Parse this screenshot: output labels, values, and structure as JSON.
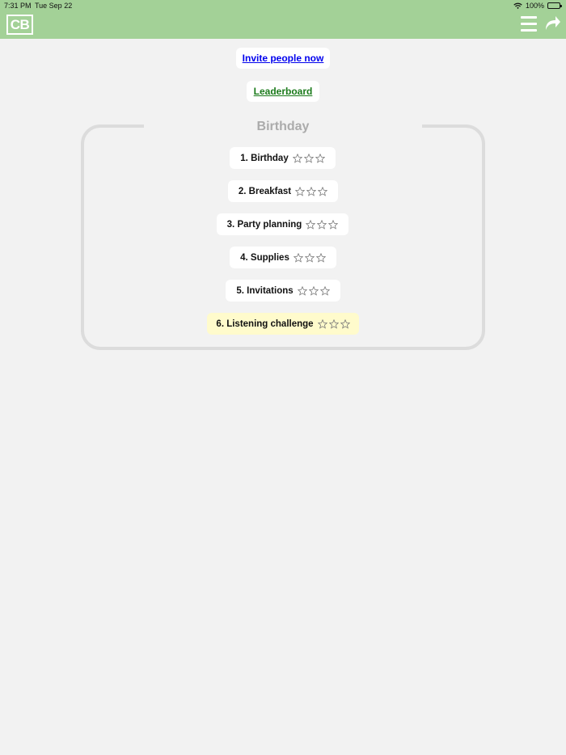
{
  "status_bar": {
    "time": "7:31 PM",
    "date": "Tue Sep 22",
    "battery": "100%"
  },
  "header": {
    "logo_text": "CB",
    "background_color": "#a3d197",
    "icons": [
      "menu-icon",
      "share-icon"
    ]
  },
  "links": {
    "invite_label": "Invite people now",
    "leaderboard_label": "Leaderboard"
  },
  "group": {
    "title": "Birthday",
    "lessons": [
      {
        "label": "1. Birthday",
        "stars": 0,
        "max_stars": 3
      },
      {
        "label": "2. Breakfast",
        "stars": 0,
        "max_stars": 3
      },
      {
        "label": "3. Party planning",
        "stars": 0,
        "max_stars": 3
      },
      {
        "label": "4. Supplies",
        "stars": 0,
        "max_stars": 3
      },
      {
        "label": "5. Invitations",
        "stars": 0,
        "max_stars": 3
      },
      {
        "label": "6. Listening challenge",
        "stars": 0,
        "max_stars": 3,
        "highlighted": true
      }
    ]
  },
  "colors": {
    "invite_link": "#0000ee",
    "leaderboard_link": "#1a7a1a",
    "highlight": "#fffbcc"
  }
}
